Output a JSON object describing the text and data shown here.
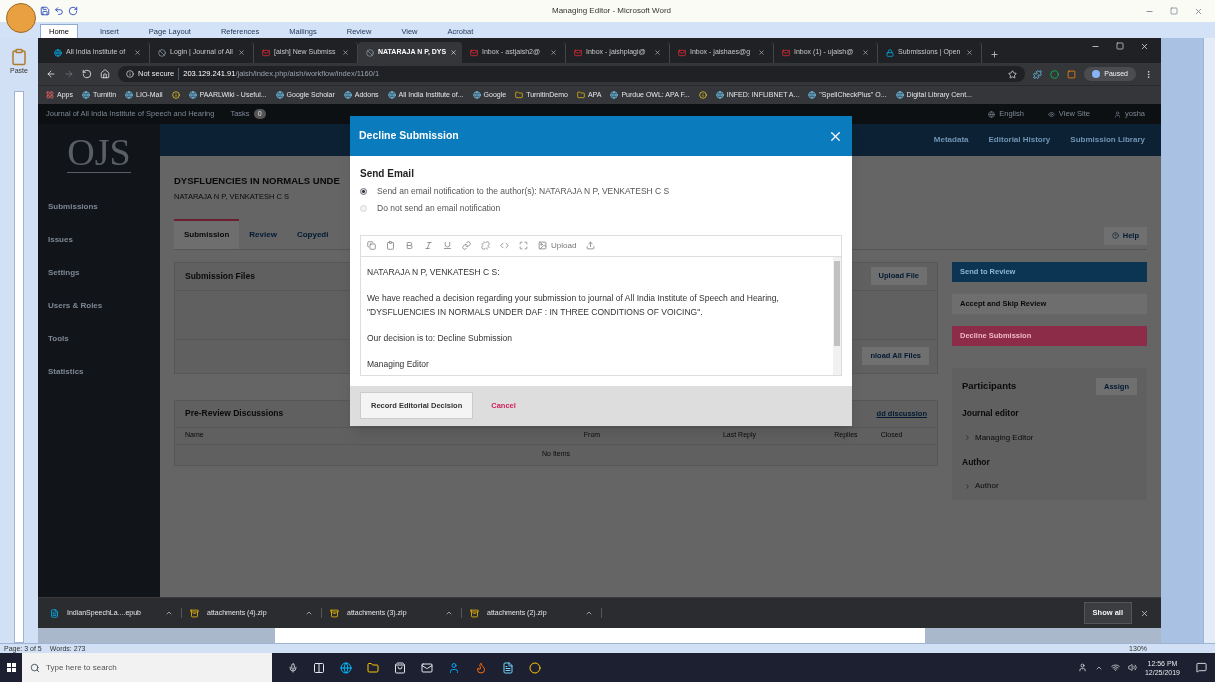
{
  "word": {
    "title": "Managing Editor - Microsoft Word",
    "ribbon_tabs": [
      {
        "label": "Home",
        "selected": true
      },
      {
        "label": "Insert",
        "selected": false
      },
      {
        "label": "Page Layout",
        "selected": false
      },
      {
        "label": "References",
        "selected": false
      },
      {
        "label": "Mailings",
        "selected": false
      },
      {
        "label": "Review",
        "selected": false
      },
      {
        "label": "View",
        "selected": false
      },
      {
        "label": "Acrobat",
        "selected": false
      }
    ],
    "paste_label": "Paste",
    "status_bar": {
      "page": "Page: 3 of 5",
      "words": "Words: 273",
      "zoom": "130%"
    }
  },
  "browser": {
    "tabs": [
      {
        "kind": "site",
        "label": "All India Institute of",
        "selected": false
      },
      {
        "kind": "blocked",
        "label": "Login | Journal of All",
        "selected": false
      },
      {
        "kind": "mail",
        "label": "[aish] New Submiss",
        "selected": false
      },
      {
        "kind": "blocked",
        "label": "NATARAJA N P, DYS",
        "selected": true
      },
      {
        "kind": "mail",
        "label": "Inbox - astjaish2@",
        "selected": false
      },
      {
        "kind": "mail",
        "label": "Inbox - jaishplagi@",
        "selected": false
      },
      {
        "kind": "mail",
        "label": "Inbox - jaishaes@g",
        "selected": false
      },
      {
        "kind": "mail",
        "label": "Inbox (1) - ujaish@",
        "selected": false
      },
      {
        "kind": "lock",
        "label": "Submissions | Open",
        "selected": false
      }
    ],
    "address": {
      "security": "Not secure",
      "host": "203.129.241.91",
      "path": "/jaish/index.php/aish/workflow/index/1160/1"
    },
    "profile": "Paused",
    "bookmarks": [
      {
        "kind": "apps",
        "label": "Apps"
      },
      {
        "kind": "site",
        "label": "Turnitin"
      },
      {
        "kind": "site",
        "label": "LIO-Mail"
      },
      {
        "kind": "info"
      },
      {
        "kind": "site",
        "label": "PAARLWiki - Useful..."
      },
      {
        "kind": "site",
        "label": "Google Scholar"
      },
      {
        "kind": "site",
        "label": "Addons"
      },
      {
        "kind": "site",
        "label": "All India Institute of..."
      },
      {
        "kind": "site",
        "label": "Google"
      },
      {
        "kind": "folder",
        "label": "TurnitinDemo"
      },
      {
        "kind": "folder",
        "label": "APA"
      },
      {
        "kind": "site",
        "label": "Purdue OWL: APA F..."
      },
      {
        "kind": "info"
      },
      {
        "kind": "site",
        "label": "INFED: INFLIBNET A..."
      },
      {
        "kind": "site",
        "label": "\"SpellCheckPlus\" O..."
      },
      {
        "kind": "site",
        "label": "Digital Library Cent..."
      }
    ],
    "downloads": [
      {
        "kind": "ebook",
        "name": "IndianSpeechLa....epub"
      },
      {
        "kind": "archive",
        "name": "attachments (4).zip"
      },
      {
        "kind": "archive",
        "name": "attachments (3).zip"
      },
      {
        "kind": "archive",
        "name": "attachments (2).zip"
      }
    ],
    "show_all": "Show all"
  },
  "ojs": {
    "journal": "Journal of All India Institute of Speech and Hearing",
    "tasks_label": "Tasks",
    "tasks_count": "0",
    "user_links": [
      {
        "kind": "language",
        "label": "English"
      },
      {
        "kind": "view",
        "label": "View Site"
      },
      {
        "kind": "user",
        "label": "yosha"
      }
    ],
    "logo": "OJS",
    "nav": [
      "Submissions",
      "Issues",
      "Settings",
      "Users & Roles",
      "Tools",
      "Statistics"
    ],
    "header_links": [
      "Metadata",
      "Editorial History",
      "Submission Library"
    ],
    "title": "DYSFLUENCIES IN NORMALS UNDE",
    "authors": "NATARAJA N P, VENKATESH C S",
    "stage_tabs": [
      {
        "label": "Submission",
        "selected": true
      },
      {
        "label": "Review",
        "selected": false
      },
      {
        "label": "Copyedi",
        "selected": false
      }
    ],
    "help": "Help",
    "files": {
      "title": "Submission Files",
      "upload": "Upload File",
      "download_all": "nload All Files"
    },
    "discussions": {
      "title": "Pre-Review Discussions",
      "add": "dd discussion",
      "columns": [
        "Name",
        "From",
        "Last Reply",
        "Replies",
        "Closed"
      ],
      "empty": "No Items"
    },
    "actions": [
      {
        "kind": "primary",
        "label": "Send to Review"
      },
      {
        "kind": "default",
        "label": "Accept and Skip Review"
      },
      {
        "kind": "danger",
        "label": "Decline Submission"
      }
    ],
    "participants": {
      "title": "Participants",
      "assign": "Assign",
      "groups": [
        {
          "role": "Journal editor",
          "members": [
            "Managing Editor"
          ]
        },
        {
          "role": "Author",
          "members": [
            "Author"
          ]
        }
      ]
    }
  },
  "dialog": {
    "title": "Decline Submission",
    "section": "Send Email",
    "options": [
      {
        "label": "Send an email notification to the author(s): NATARAJA N P, VENKATESH C S",
        "selected": true
      },
      {
        "label": "Do not send an email notification",
        "selected": false
      }
    ],
    "toolbar": [
      {
        "kind": "copy"
      },
      {
        "kind": "paste"
      },
      {
        "kind": "bold"
      },
      {
        "kind": "italic"
      },
      {
        "kind": "underline"
      },
      {
        "kind": "link"
      },
      {
        "kind": "unlink"
      },
      {
        "kind": "code"
      },
      {
        "kind": "fullscreen"
      },
      {
        "kind": "image",
        "label": "Upload"
      },
      {
        "kind": "upload"
      }
    ],
    "message": [
      "NATARAJA N P, VENKATESH C S:",
      "We have reached a decision regarding your submission to journal of All India Institute of Speech and Hearing, \"DYSFLUENCIES IN NORMALS UNDER DAF : IN THREE CONDITIONS OF VOICING\".",
      "Our decision is to: Decline Submission",
      "Managing Editor"
    ],
    "submit": "Record Editorial Decision",
    "cancel": "Cancel"
  },
  "taskbar": {
    "search_placeholder": "Type here to search",
    "time": "12:56 PM",
    "date": "12/25/2019"
  }
}
